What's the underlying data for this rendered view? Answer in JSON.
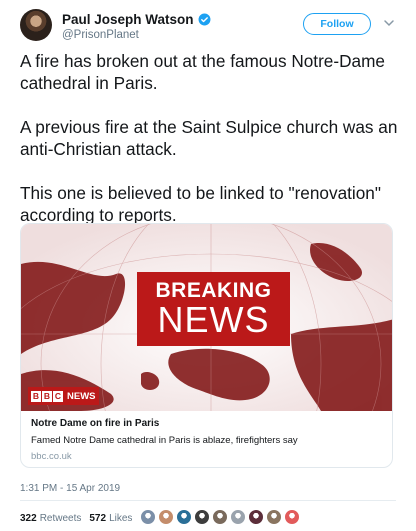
{
  "user": {
    "display_name": "Paul Joseph Watson",
    "handle": "@PrisonPlanet",
    "verified_icon": "verified-badge-icon"
  },
  "follow_label": "Follow",
  "tweet": {
    "paragraphs": [
      "A fire has broken out at the famous Notre-Dame cathedral in Paris.",
      "A previous fire at the Saint Sulpice church was an anti-Christian attack.",
      "This one is believed to be linked to \"renovation\" according to reports."
    ]
  },
  "card": {
    "image_breaking": "BREAKING",
    "image_news": "NEWS",
    "bbc_letters": [
      "B",
      "B",
      "C"
    ],
    "bbc_news_label": "NEWS",
    "title": "Notre Dame on fire in Paris",
    "description": "Famed Notre Dame cathedral in Paris is ablaze, firefighters say",
    "domain": "bbc.co.uk"
  },
  "timestamp": "1:31 PM - 15 Apr 2019",
  "stats": {
    "retweets_count": "322",
    "retweets_label": "Retweets",
    "likes_count": "572",
    "likes_label": "Likes"
  },
  "likers": [
    "#7b8fa8",
    "#c48d6b",
    "#2a6f97",
    "#3d3d3d",
    "#7a6a5c",
    "#9aa3ad",
    "#5c2e3a",
    "#8a7560",
    "#e25b5b"
  ],
  "colors": {
    "twitter_blue": "#1da1f2",
    "bbc_red": "#bb1919"
  }
}
